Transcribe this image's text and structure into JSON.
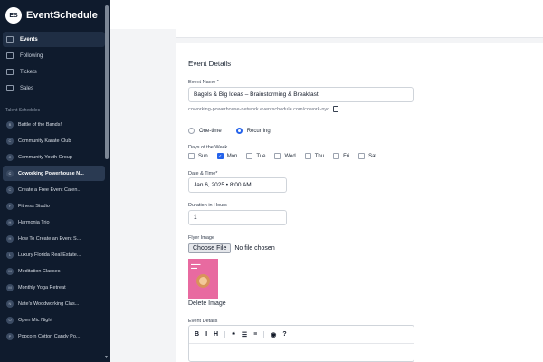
{
  "app": {
    "name": "EventSchedule",
    "logo_initials": "ES"
  },
  "nav": [
    {
      "label": "Events",
      "icon": "calendar-icon",
      "active": true
    },
    {
      "label": "Following",
      "icon": "list-icon"
    },
    {
      "label": "Tickets",
      "icon": "ticket-icon"
    },
    {
      "label": "Sales",
      "icon": "receipt-icon"
    }
  ],
  "schedules_label": "Talent Schedules",
  "schedules": [
    {
      "initial": "B",
      "label": "Battle of the Bands!"
    },
    {
      "initial": "C",
      "label": "Community Karate Club"
    },
    {
      "initial": "C",
      "label": "Community Youth Group"
    },
    {
      "initial": "C",
      "label": "Coworking Powerhouse N...",
      "active": true
    },
    {
      "initial": "C",
      "label": "Create a Free Event Calen..."
    },
    {
      "initial": "F",
      "label": "Fitness Studio"
    },
    {
      "initial": "H",
      "label": "Harmonia Trio"
    },
    {
      "initial": "H",
      "label": "How To Create an Event S..."
    },
    {
      "initial": "L",
      "label": "Luxury Florida Real Estate..."
    },
    {
      "initial": "M",
      "label": "Meditation Classes"
    },
    {
      "initial": "M",
      "label": "Monthly Yoga Retreat"
    },
    {
      "initial": "N",
      "label": "Nate's Woodworking Clas..."
    },
    {
      "initial": "O",
      "label": "Open Mic Night"
    },
    {
      "initial": "P",
      "label": "Popcorn Cotton Candy Po..."
    }
  ],
  "form": {
    "title": "Event Details",
    "event_name_label": "Event Name *",
    "event_name_value": "Bagels & Big Ideas – Brainstorming & Breakfast!",
    "url": "coworking-powerhouse-network.eventschedule.com/cowork-nyc",
    "one_time_label": "One-time",
    "recurring_label": "Recurring",
    "recurring_selected": true,
    "days_label": "Days of the Week",
    "days": [
      {
        "label": "Sun",
        "checked": false
      },
      {
        "label": "Mon",
        "checked": true
      },
      {
        "label": "Tue",
        "checked": false
      },
      {
        "label": "Wed",
        "checked": false
      },
      {
        "label": "Thu",
        "checked": false
      },
      {
        "label": "Fri",
        "checked": false
      },
      {
        "label": "Sat",
        "checked": false
      }
    ],
    "datetime_label": "Date & Time*",
    "datetime_value": "Jan 6, 2025 • 8:00 AM",
    "duration_label": "Duration in Hours",
    "duration_value": "1",
    "flyer_label": "Flyer Image",
    "choose_file_label": "Choose File",
    "no_file_label": "No file chosen",
    "delete_image_label": "Delete Image",
    "details_label": "Event Details",
    "toolbar": [
      "B",
      "I",
      "H",
      "❝",
      "☰",
      "≡",
      "◉",
      "?"
    ]
  }
}
